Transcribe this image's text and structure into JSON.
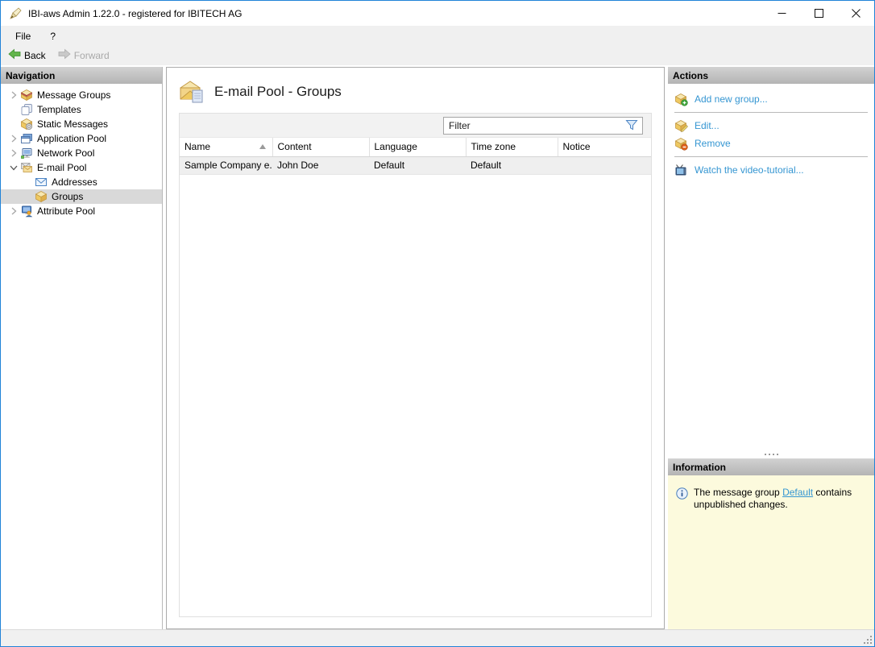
{
  "window": {
    "title": "IBI-aws Admin 1.22.0 - registered for IBITECH AG",
    "controls": {
      "minimize": "–",
      "maximize": "□",
      "close": "✕"
    }
  },
  "menu": {
    "items": [
      {
        "label": "File"
      },
      {
        "label": "?"
      }
    ]
  },
  "toolbar": {
    "back_label": "Back",
    "forward_label": "Forward"
  },
  "navigation": {
    "header": "Navigation",
    "items": [
      {
        "label": "Message Groups",
        "icon": "message-groups-icon",
        "state": "collapsed"
      },
      {
        "label": "Templates",
        "icon": "templates-icon",
        "state": "leaf"
      },
      {
        "label": "Static Messages",
        "icon": "static-messages-icon",
        "state": "leaf"
      },
      {
        "label": "Application Pool",
        "icon": "application-pool-icon",
        "state": "collapsed"
      },
      {
        "label": "Network Pool",
        "icon": "network-pool-icon",
        "state": "collapsed"
      },
      {
        "label": "E-mail Pool",
        "icon": "email-pool-icon",
        "state": "expanded"
      },
      {
        "label": "Addresses",
        "icon": "addresses-icon",
        "state": "leaf",
        "indent": 1
      },
      {
        "label": "Groups",
        "icon": "groups-icon",
        "state": "leaf",
        "indent": 1,
        "selected": true
      },
      {
        "label": "Attribute Pool",
        "icon": "attribute-pool-icon",
        "state": "collapsed"
      }
    ]
  },
  "main": {
    "title": "E-mail Pool - Groups",
    "filter": {
      "placeholder": "Filter",
      "icon": "filter-funnel-icon"
    },
    "table": {
      "columns": [
        "Name",
        "Content",
        "Language",
        "Time zone",
        "Notice"
      ],
      "sort": {
        "column": "Name",
        "direction": "ascending"
      },
      "rows": [
        [
          "Sample Company e...",
          "John Doe",
          "Default",
          "Default",
          ""
        ]
      ]
    }
  },
  "actions": {
    "header": "Actions",
    "items": [
      {
        "label": "Add new group...",
        "icon": "add-group-icon"
      },
      {
        "label": "Edit...",
        "icon": "edit-group-icon"
      },
      {
        "label": "Remove",
        "icon": "remove-group-icon"
      },
      {
        "label": "Watch the video-tutorial...",
        "icon": "video-tutorial-icon"
      }
    ]
  },
  "information": {
    "header": "Information",
    "text_before": "The message group ",
    "link": "Default",
    "text_after": " contains unpublished changes."
  },
  "colors": {
    "accent_link": "#3596d2",
    "info_background": "#fcfadd",
    "selection_gray": "#d9d9d9",
    "window_border": "#2183d8"
  }
}
